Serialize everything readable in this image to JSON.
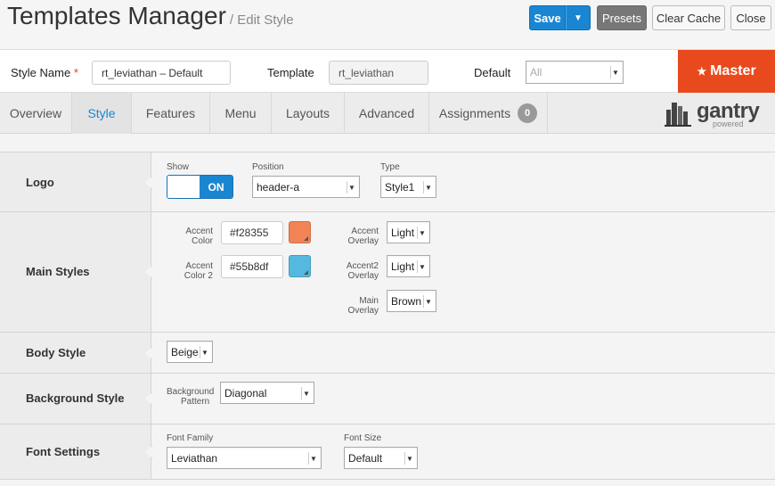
{
  "header": {
    "title": "Templates Manager",
    "subtitle": "/ Edit Style",
    "buttons": {
      "save": "Save",
      "presets": "Presets",
      "clear_cache": "Clear Cache",
      "close": "Close"
    }
  },
  "style_bar": {
    "style_name_label": "Style Name",
    "required_mark": "*",
    "style_name_value": "rt_leviathan – Default",
    "template_label": "Template",
    "template_value": "rt_leviathan",
    "default_label": "Default",
    "default_value": "All",
    "master_label": "Master"
  },
  "tabs": [
    {
      "label": "Overview"
    },
    {
      "label": "Style"
    },
    {
      "label": "Features"
    },
    {
      "label": "Menu"
    },
    {
      "label": "Layouts"
    },
    {
      "label": "Advanced"
    },
    {
      "label": "Assignments",
      "count": "0"
    }
  ],
  "brand": {
    "name": "gantry",
    "tagline": "powered"
  },
  "sections": {
    "logo": {
      "title": "Logo",
      "show_label": "Show",
      "show_value": "ON",
      "position_label": "Position",
      "position_value": "header-a",
      "type_label": "Type",
      "type_value": "Style1"
    },
    "main_styles": {
      "title": "Main Styles",
      "accent_color_label_1": "Accent",
      "accent_color_label_2": "Color",
      "accent_color_value": "#f28355",
      "accent_color2_label_1": "Accent",
      "accent_color2_label_2": "Color 2",
      "accent_color2_value": "#55b8df",
      "accent_overlay_label_1": "Accent",
      "accent_overlay_label_2": "Overlay",
      "accent_overlay_value": "Light",
      "accent2_overlay_label_1": "Accent2",
      "accent2_overlay_label_2": "Overlay",
      "accent2_overlay_value": "Light",
      "main_overlay_label_1": "Main",
      "main_overlay_label_2": "Overlay",
      "main_overlay_value": "Brown"
    },
    "body_style": {
      "title": "Body Style",
      "value": "Beige"
    },
    "background_style": {
      "title": "Background Style",
      "pattern_label_1": "Background",
      "pattern_label_2": "Pattern",
      "pattern_value": "Diagonal"
    },
    "font_settings": {
      "title": "Font Settings",
      "family_label": "Font Family",
      "family_value": "Leviathan",
      "size_label": "Font Size",
      "size_value": "Default"
    }
  },
  "colors": {
    "primary": "#1a86d2",
    "master": "#e8491d",
    "accent": "#f28355",
    "accent2": "#55b8df"
  },
  "icons": {
    "dropdown": "chevron-down-icon",
    "star": "star-icon",
    "brand_logo": "gantry-building-icon"
  }
}
